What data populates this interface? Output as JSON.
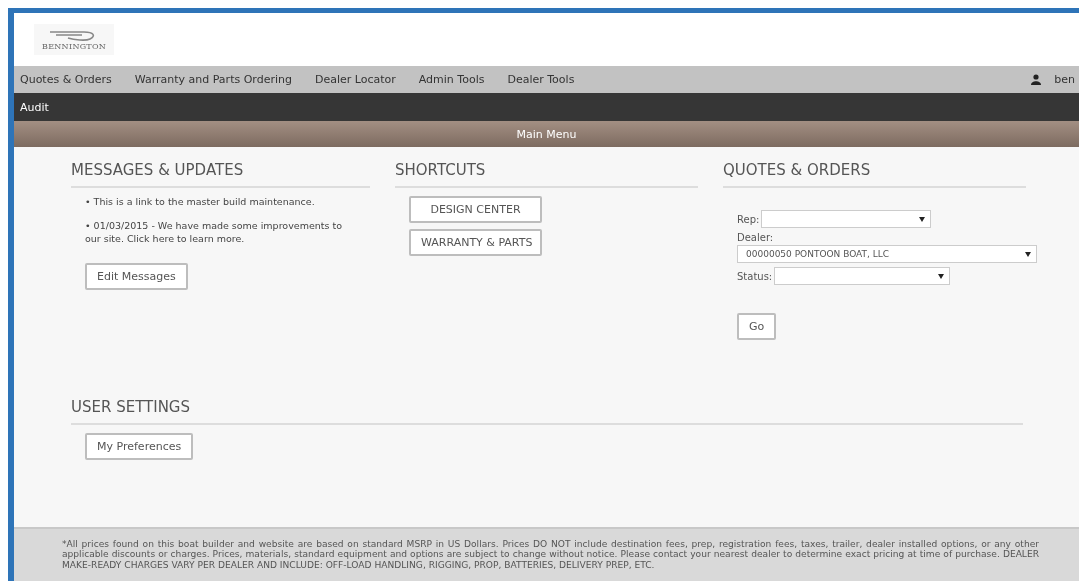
{
  "logo": {
    "text": "BENNINGTON"
  },
  "nav": {
    "items": [
      {
        "label": "Quotes & Orders"
      },
      {
        "label": "Warranty and Parts Ordering"
      },
      {
        "label": "Dealer Locator"
      },
      {
        "label": "Admin Tools"
      },
      {
        "label": "Dealer Tools"
      }
    ],
    "user": "ben"
  },
  "subnav": {
    "items": [
      {
        "label": "Audit"
      }
    ]
  },
  "banner": {
    "title": "Main Menu"
  },
  "messages": {
    "title": "MESSAGES & UPDATES",
    "items": [
      "• This is a link to the master build maintenance.",
      "• 01/03/2015 - We have made some improvements to our site. Click here to learn more."
    ],
    "button": "Edit Messages"
  },
  "shortcuts": {
    "title": "SHORTCUTS",
    "buttons": [
      "DESIGN CENTER",
      "WARRANTY & PARTS"
    ]
  },
  "quotes": {
    "title": "QUOTES & ORDERS",
    "fields": [
      {
        "label": "Rep:",
        "kind": "inline"
      },
      {
        "label": "Dealer:",
        "value": "00000050 PONTOON BOAT, LLC",
        "kind": "stacked"
      },
      {
        "label": "Status:",
        "kind": "inline"
      }
    ],
    "button": "Go"
  },
  "user_settings": {
    "title": "USER SETTINGS",
    "button": "My Preferences"
  },
  "footer": {
    "text": "*All prices found on this boat builder and website are based on standard MSRP in US Dollars. Prices DO NOT include destination fees, prep, registration fees, taxes, trailer, dealer installed options, or any other applicable discounts or charges. Prices, materials, standard equipment and options are subject to change without notice. Please contact your nearest dealer to determine exact pricing at time of purchase. DEALER MAKE-READY CHARGES VARY PER DEALER AND INCLUDE: OFF-LOAD HANDLING, RIGGING, PROP, BATTERIES, DELIVERY PREP, ETC."
  }
}
